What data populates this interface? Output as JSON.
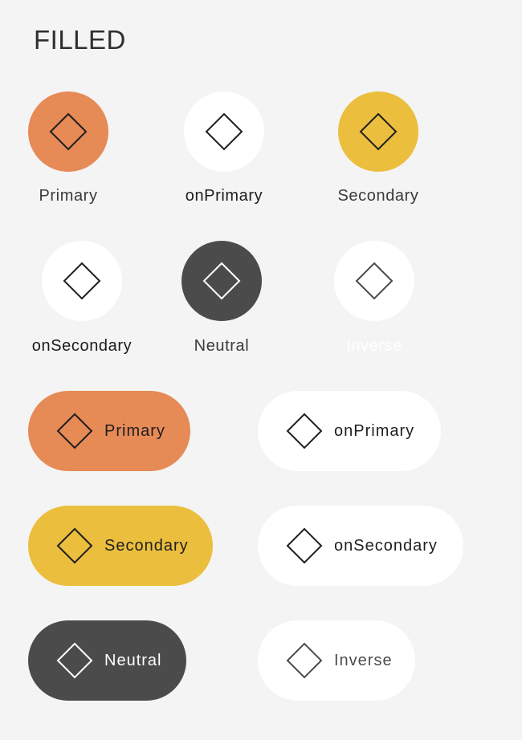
{
  "title": "FILLED",
  "icon_name": "diamond-icon",
  "colors": {
    "background": "#f4f4f4",
    "primary": "#e68a56",
    "secondary": "#ebbe3e",
    "neutral": "#4b4b4b",
    "white": "#ffffff"
  },
  "icon_buttons": [
    {
      "label": "Primary"
    },
    {
      "label": "onPrimary"
    },
    {
      "label": "Secondary"
    },
    {
      "label": "onSecondary"
    },
    {
      "label": "Neutral"
    },
    {
      "label": "Inverse"
    }
  ],
  "pill_buttons": [
    {
      "label": "Primary"
    },
    {
      "label": "onPrimary"
    },
    {
      "label": "Secondary"
    },
    {
      "label": "onSecondary"
    },
    {
      "label": "Neutral"
    },
    {
      "label": "Inverse"
    }
  ]
}
